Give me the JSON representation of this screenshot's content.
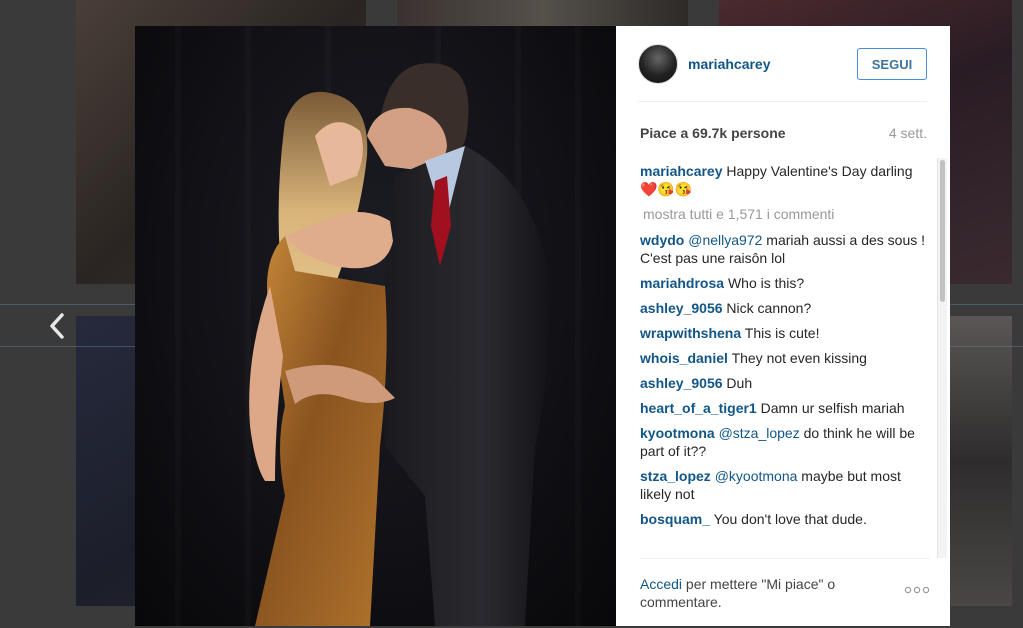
{
  "post": {
    "username": "mariahcarey",
    "follow_label": "SEGUI",
    "likes": "Piace a 69.7k persone",
    "time": "4 sett."
  },
  "caption": {
    "user": "mariahcarey",
    "text": "Happy Valentine's Day darling ❤️😘😘"
  },
  "show_all_comments": "mostra tutti e 1,571 i commenti",
  "comments": [
    {
      "user": "wdydo",
      "mention": "@nellya972",
      "text": "mariah aussi a des sous ! C'est pas une raisôn lol"
    },
    {
      "user": "mariahdrosa",
      "mention": "",
      "text": "Who is this?"
    },
    {
      "user": "ashley_9056",
      "mention": "",
      "text": "Nick cannon?"
    },
    {
      "user": "wrapwithshena",
      "mention": "",
      "text": "This is cute!"
    },
    {
      "user": "whois_daniel",
      "mention": "",
      "text": "They not even kissing"
    },
    {
      "user": "ashley_9056",
      "mention": "",
      "text": "Duh"
    },
    {
      "user": "heart_of_a_tiger1",
      "mention": "",
      "text": "Damn ur selfish mariah"
    },
    {
      "user": "kyootmona",
      "mention": "@stza_lopez",
      "text": "do think he will be part of it??"
    },
    {
      "user": "stza_lopez",
      "mention": "@kyootmona",
      "text": "maybe but most likely not"
    },
    {
      "user": "bosquam_",
      "mention": "",
      "text": "You don't love that dude."
    }
  ],
  "footer": {
    "login_link": "Accedi",
    "login_text": "per mettere \"Mi piace\" o commentare."
  },
  "icons": {
    "prev": "chevron-left-icon",
    "more": "more-options-icon"
  },
  "colors": {
    "link": "#125688",
    "follow_border": "#4090db",
    "muted": "#999999"
  }
}
